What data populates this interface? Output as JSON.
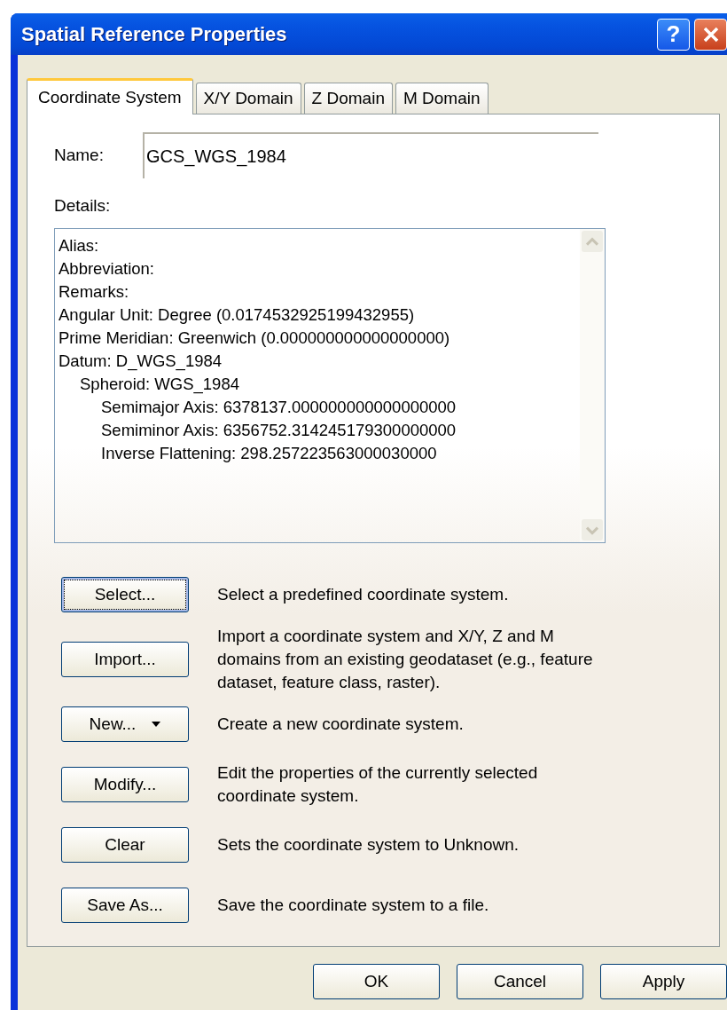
{
  "window": {
    "title": "Spatial Reference Properties",
    "title_buttons": [
      {
        "kind": "help",
        "label": "?"
      },
      {
        "kind": "close"
      }
    ]
  },
  "tabs": [
    {
      "label": "Coordinate System",
      "selected": true
    },
    {
      "label": "X/Y Domain",
      "selected": false
    },
    {
      "label": "Z Domain",
      "selected": false
    },
    {
      "label": "M Domain",
      "selected": false
    }
  ],
  "name": {
    "label": "Name:",
    "value": "GCS_WGS_1984"
  },
  "details": {
    "label": "Details:",
    "lines": [
      {
        "text": "Alias:"
      },
      {
        "text": "Abbreviation:"
      },
      {
        "text": "Remarks:"
      },
      {
        "text": "Angular Unit: Degree (0.0174532925199432955)"
      },
      {
        "text": "Prime Meridian: Greenwich (0.000000000000000000)"
      },
      {
        "text": "Datum: D_WGS_1984",
        "children": [
          {
            "text": "Spheroid: WGS_1984",
            "children": [
              {
                "text": "Semimajor Axis: 6378137.000000000000000000"
              },
              {
                "text": "Semiminor Axis: 6356752.314245179300000000"
              },
              {
                "text": "Inverse Flattening: 298.257223563000030000"
              }
            ]
          }
        ]
      }
    ]
  },
  "actions": [
    {
      "label": "Select...",
      "focused": true,
      "dropdown": false,
      "description": "Select a predefined coordinate system."
    },
    {
      "label": "Import...",
      "focused": false,
      "dropdown": false,
      "description": "Import a coordinate system and X/Y, Z and M domains from an existing geodataset (e.g., feature dataset, feature class, raster)."
    },
    {
      "label": "New...",
      "focused": false,
      "dropdown": true,
      "description": "Create a new coordinate system."
    },
    {
      "label": "Modify...",
      "focused": false,
      "dropdown": false,
      "description": "Edit the properties of the currently selected coordinate system."
    },
    {
      "label": "Clear",
      "focused": false,
      "dropdown": false,
      "description": "Sets the coordinate system to Unknown."
    },
    {
      "label": "Save As...",
      "focused": false,
      "dropdown": false,
      "description": "Save the coordinate system to a file."
    }
  ],
  "buttons": [
    "OK",
    "Cancel",
    "Apply"
  ]
}
